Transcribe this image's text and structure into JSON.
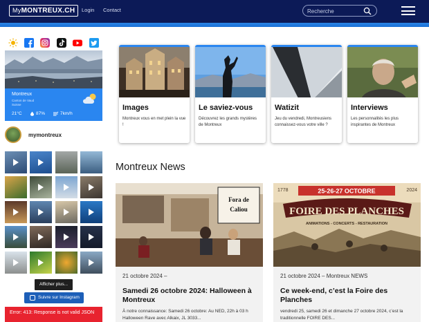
{
  "header": {
    "logo_prefix": "My",
    "logo_main": "MONTREUX.CH",
    "nav": [
      "Login",
      "Contact"
    ],
    "search_placeholder": "Recherche"
  },
  "social_icons": [
    "sun-icon",
    "facebook-icon",
    "instagram-icon",
    "tiktok-icon",
    "youtube-icon",
    "twitter-icon"
  ],
  "weather": {
    "city": "Montreux",
    "region_line1": "Canton de Vaud",
    "region_line2": "Suisse",
    "temperature": "21°C",
    "humidity": "87%",
    "wind": "7km/h"
  },
  "instagram": {
    "handle": "mymontreux",
    "more_label": "Afficher plus...",
    "follow_label": "Suivre sur Instagram",
    "error_text": "Error: 413: Response is not valid JSON"
  },
  "feature_cards": [
    {
      "title": "Images",
      "description": "Montreux vous en met plein la vue !"
    },
    {
      "title": "Le saviez-vous",
      "description": "Découvrez les  grands mystères de Montreux"
    },
    {
      "title": "Watizit",
      "description": "Jeu du vendredi, Montreusiens connaissez-vous votre ville ?"
    },
    {
      "title": "Interviews",
      "description": "Les personnalités les plus inspirantes de Montreux"
    }
  ],
  "news_section_title": "Montreux News",
  "news": [
    {
      "date": "21 octobre 2024 –",
      "headline": "Samedi 26 octobre 2024: Halloween à Montreux",
      "excerpt": "À notre connaissance: Samedi 26 octobre: Au NED, 22h à 03 h Halloween Rave avec Alkaix, JL 3033...",
      "image_sign_line1": "Fora de",
      "image_sign_line2": "Caliou"
    },
    {
      "date": "21 octobre 2024 – Montreux NEWS",
      "headline": "Ce week-end, c’est la Foire des Planches",
      "excerpt": "vendredi 25, samedi 26 et dimanche 27 octobre 2024, c’est la traditionnelle FOIRE DES...",
      "poster_dates": "25-26-27 OCTOBRE",
      "poster_year_left": "1778",
      "poster_year_right": "2024",
      "poster_title": "FOIRE DES PLANCHES",
      "poster_subtitle": "ANIMATIONS - CONCERTS - RESTAURATION"
    }
  ]
}
